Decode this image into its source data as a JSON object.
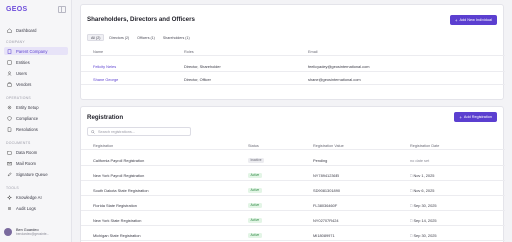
{
  "app": {
    "logo": "GEOS"
  },
  "sidebar": {
    "items": [
      {
        "label": "Dashboard",
        "icon": "home-icon"
      },
      {
        "section": "COMPANY"
      },
      {
        "label": "Parent Company",
        "icon": "building-icon",
        "active": true
      },
      {
        "label": "Entities",
        "icon": "entities-icon"
      },
      {
        "label": "Users",
        "icon": "users-icon"
      },
      {
        "label": "Vendors",
        "icon": "vendors-icon"
      },
      {
        "section": "OPERATIONS"
      },
      {
        "label": "Entity Setup",
        "icon": "gear-icon"
      },
      {
        "label": "Compliance",
        "icon": "shield-icon"
      },
      {
        "label": "Resolutions",
        "icon": "document-icon"
      },
      {
        "section": "DOCUMENTS"
      },
      {
        "label": "Data Room",
        "icon": "folder-icon"
      },
      {
        "label": "Mail Room",
        "icon": "mail-icon"
      },
      {
        "label": "Signature Queue",
        "icon": "pen-icon"
      },
      {
        "section": "TOOLS"
      },
      {
        "label": "Knowledge AI",
        "icon": "sparkle-icon"
      },
      {
        "label": "Audit Logs",
        "icon": "list-icon"
      }
    ],
    "user": {
      "name": "Ben Guardeo",
      "email": "bendardeo@geosinte..."
    }
  },
  "officers": {
    "title": "Shareholders, Directors and Officers",
    "add_button": "Add New Individual",
    "tabs": [
      "All (2)",
      "Directors (2)",
      "Officers (1)",
      "Shareholders (1)"
    ],
    "columns": [
      "Name",
      "Roles",
      "Email"
    ],
    "rows": [
      {
        "name": "Felicity Neles",
        "roles": "Director, Shareholder",
        "email": "feelicyadey@geosinternational.com"
      },
      {
        "name": "Shane George",
        "roles": "Director, Officer",
        "email": "shane@geosinternational.com"
      }
    ]
  },
  "registration": {
    "title": "Registration",
    "add_button": "Add Registration",
    "search_placeholder": "Search registrations...",
    "columns": [
      "Registration",
      "Status",
      "Registration Value",
      "Registration Date"
    ],
    "rows": [
      {
        "name": "California Payroll Registration",
        "status": "Inactive",
        "value": "Pending",
        "date": "no date set"
      },
      {
        "name": "New York Payroll Registration",
        "status": "Active",
        "value": "NY78941236EI",
        "date": "Nov 1, 2025"
      },
      {
        "name": "South Dakota State Registration",
        "status": "Active",
        "value": "SD9081301890",
        "date": "Nov 6, 2025"
      },
      {
        "name": "Florida State Registration",
        "status": "Active",
        "value": "FL38036460F",
        "date": "Sep 30, 2025"
      },
      {
        "name": "New York State Registration",
        "status": "Active",
        "value": "NY02707R424",
        "date": "Sep 14, 2025"
      },
      {
        "name": "Michigan State Registration",
        "status": "Active",
        "value": "MI18089971",
        "date": "Sep 30, 2025"
      }
    ]
  }
}
